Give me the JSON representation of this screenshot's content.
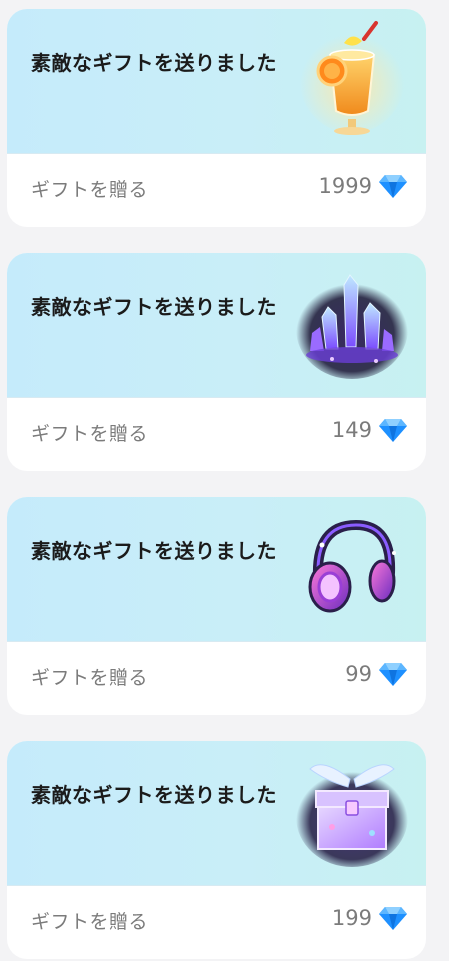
{
  "colors": {
    "card_gradient_start": "#c5ebfb",
    "card_gradient_end": "#c7f1f1",
    "diamond": "#1e90ff",
    "background": "#f3f3f5"
  },
  "cards": [
    {
      "title": "素敵なギフトを送りました",
      "send_label": "ギフトを贈る",
      "price": "1999",
      "icon": "cocktail-drink-icon"
    },
    {
      "title": "素敵なギフトを送りました",
      "send_label": "ギフトを贈る",
      "price": "149",
      "icon": "crystal-cluster-icon"
    },
    {
      "title": "素敵なギフトを送りました",
      "send_label": "ギフトを贈る",
      "price": "99",
      "icon": "headphones-icon"
    },
    {
      "title": "素敵なギフトを送りました",
      "send_label": "ギフトを贈る",
      "price": "199",
      "icon": "winged-treasure-chest-icon"
    }
  ]
}
